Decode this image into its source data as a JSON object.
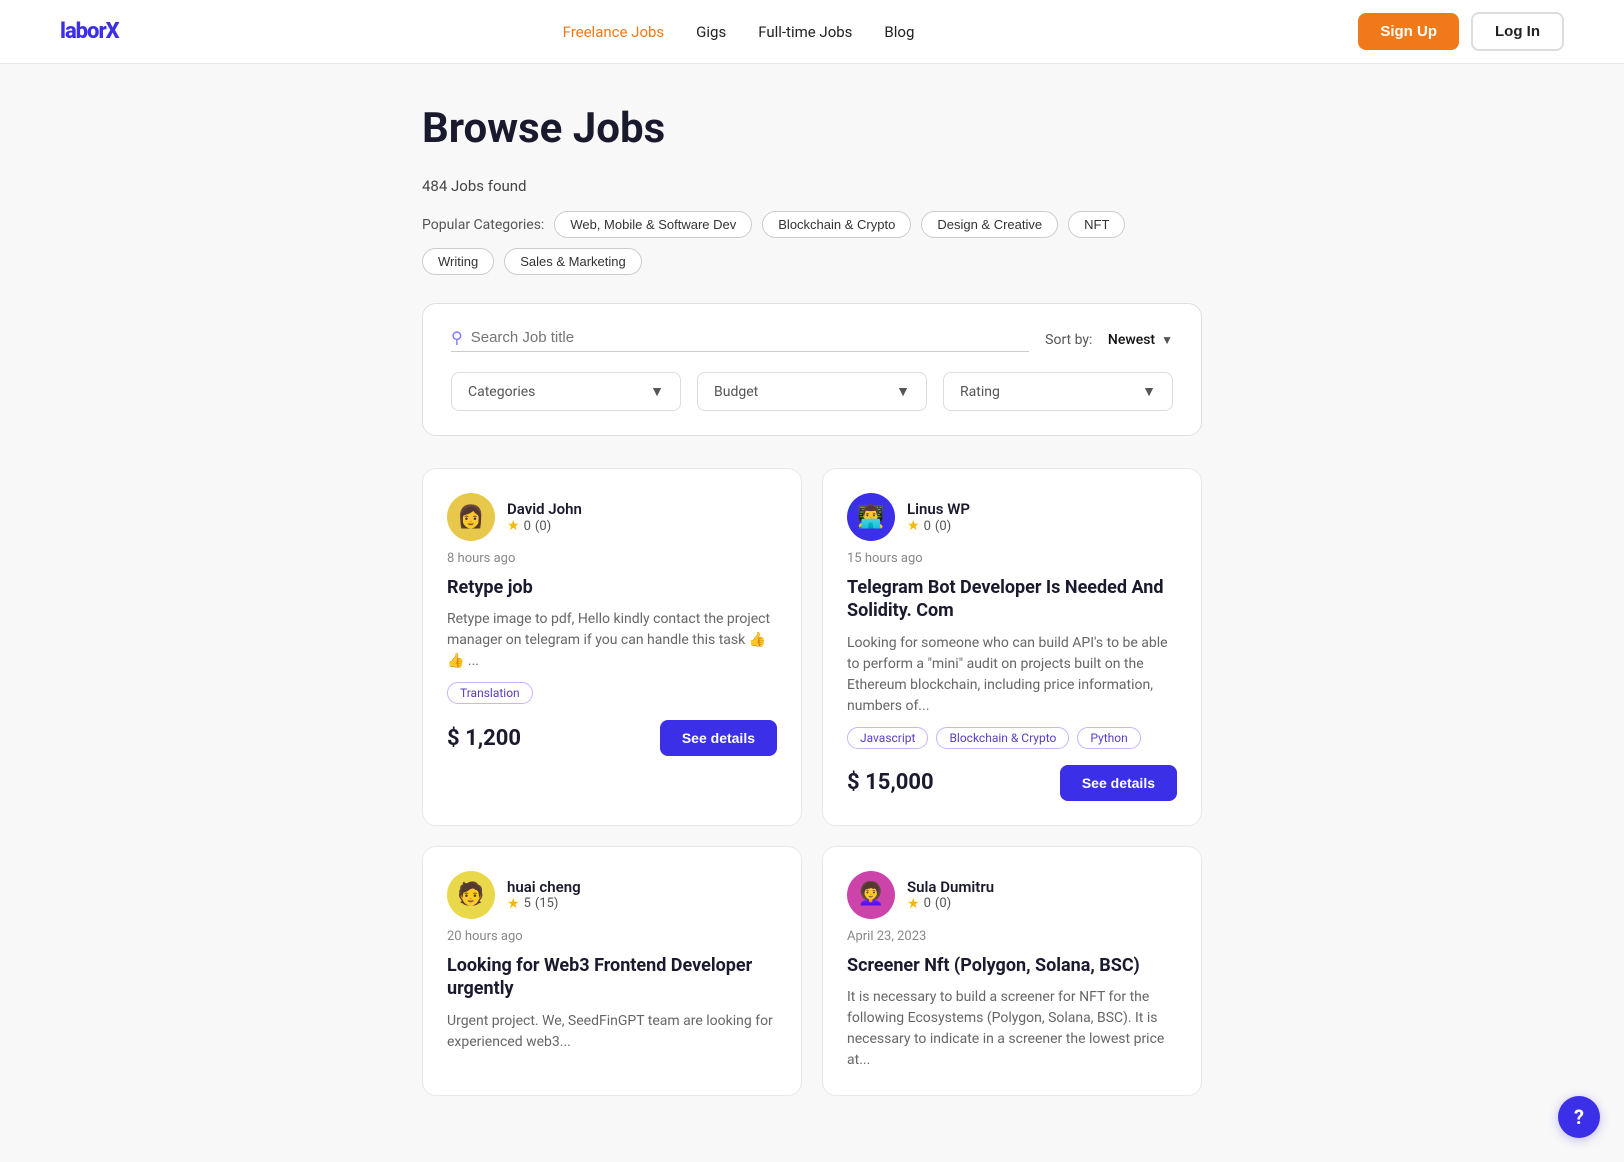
{
  "nav": {
    "logo": "laborX",
    "links": [
      {
        "label": "Freelance Jobs",
        "active": true
      },
      {
        "label": "Gigs",
        "active": false
      },
      {
        "label": "Full-time Jobs",
        "active": false
      },
      {
        "label": "Blog",
        "active": false
      }
    ],
    "signup_label": "Sign Up",
    "login_label": "Log In"
  },
  "page": {
    "title": "Browse Jobs",
    "jobs_found": "484 Jobs found",
    "categories_label": "Popular Categories:",
    "categories": [
      "Web, Mobile & Software Dev",
      "Blockchain & Crypto",
      "Design & Creative",
      "NFT",
      "Writing",
      "Sales & Marketing"
    ]
  },
  "search": {
    "placeholder": "Search Job title",
    "sort_label": "Sort by:",
    "sort_value": "Newest",
    "filters": [
      {
        "label": "Categories"
      },
      {
        "label": "Budget"
      },
      {
        "label": "Rating"
      }
    ]
  },
  "jobs": [
    {
      "id": 1,
      "user_name": "David John",
      "rating": "0",
      "rating_count": "0",
      "time": "8 hours ago",
      "title": "Retype job",
      "description": "Retype image to pdf, Hello kindly contact the project manager on telegram if you can handle this task 👍👍 ...",
      "tags": [
        "Translation"
      ],
      "price": "$ 1,200",
      "avatar_color": "#e8c84a",
      "avatar_emoji": "👩"
    },
    {
      "id": 2,
      "user_name": "Linus WP",
      "rating": "0",
      "rating_count": "0",
      "time": "15 hours ago",
      "title": "Telegram Bot Developer Is Needed And Solidity. Com",
      "description": "Looking for someone who can build API's to be able to perform a \"mini\" audit on projects built on the Ethereum blockchain, including price information, numbers of...",
      "tags": [
        "Javascript",
        "Blockchain & Crypto",
        "Python"
      ],
      "price": "$ 15,000",
      "avatar_color": "#3b2fe8",
      "avatar_emoji": "👨‍💻"
    },
    {
      "id": 3,
      "user_name": "huai cheng",
      "rating": "5",
      "rating_count": "15",
      "time": "20 hours ago",
      "title": "Looking for Web3 Frontend Developer urgently",
      "description": "Urgent project. We, SeedFinGPT team are looking for experienced web3...",
      "tags": [],
      "price": "",
      "avatar_color": "#e8d84a",
      "avatar_emoji": "🧑"
    },
    {
      "id": 4,
      "user_name": "Sula Dumitru",
      "rating": "0",
      "rating_count": "0",
      "time": "April 23, 2023",
      "title": "Screener Nft (Polygon, Solana, BSC)",
      "description": "It is necessary to build a screener for NFT for the following Ecosystems (Polygon, Solana, BSC). It is necessary to indicate in a screener the lowest price at...",
      "tags": [],
      "price": "",
      "avatar_color": "#cc44aa",
      "avatar_emoji": "👩‍🦱"
    }
  ],
  "help": {
    "icon": "?"
  }
}
